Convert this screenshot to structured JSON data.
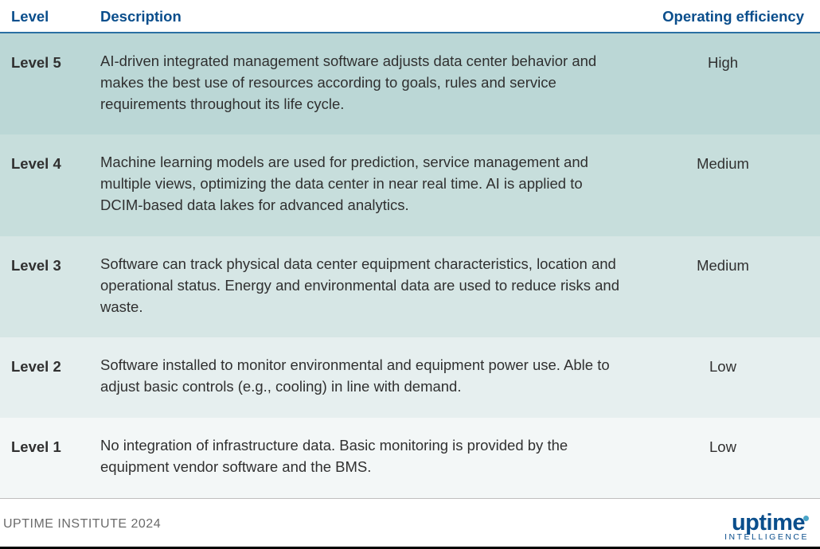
{
  "headers": {
    "level": "Level",
    "description": "Description",
    "efficiency": "Operating efficiency"
  },
  "rows": [
    {
      "level": "Level 5",
      "description": "AI-driven integrated management software adjusts data center behavior and makes the best use of resources according to goals, rules and service requirements throughout its life cycle.",
      "efficiency": "High"
    },
    {
      "level": "Level 4",
      "description": "Machine learning models are used for prediction, service management and multiple views, optimizing the data center in near real time. AI is applied to DCIM-based data lakes for advanced analytics.",
      "efficiency": "Medium"
    },
    {
      "level": "Level 3",
      "description": "Software can track physical data center equipment characteristics, location and operational status. Energy and environmental data are used to reduce risks and waste.",
      "efficiency": "Medium"
    },
    {
      "level": "Level 2",
      "description": "Software installed to monitor environmental and equipment power use. Able to adjust basic controls (e.g., cooling) in line with demand.",
      "efficiency": "Low"
    },
    {
      "level": "Level 1",
      "description": "No integration of infrastructure data. Basic monitoring is provided by the equipment vendor software and the BMS.",
      "efficiency": "Low"
    }
  ],
  "footer": {
    "source": "UPTIME INSTITUTE 2024",
    "logo_main": "uptime",
    "logo_sub": "INTELLIGENCE"
  }
}
